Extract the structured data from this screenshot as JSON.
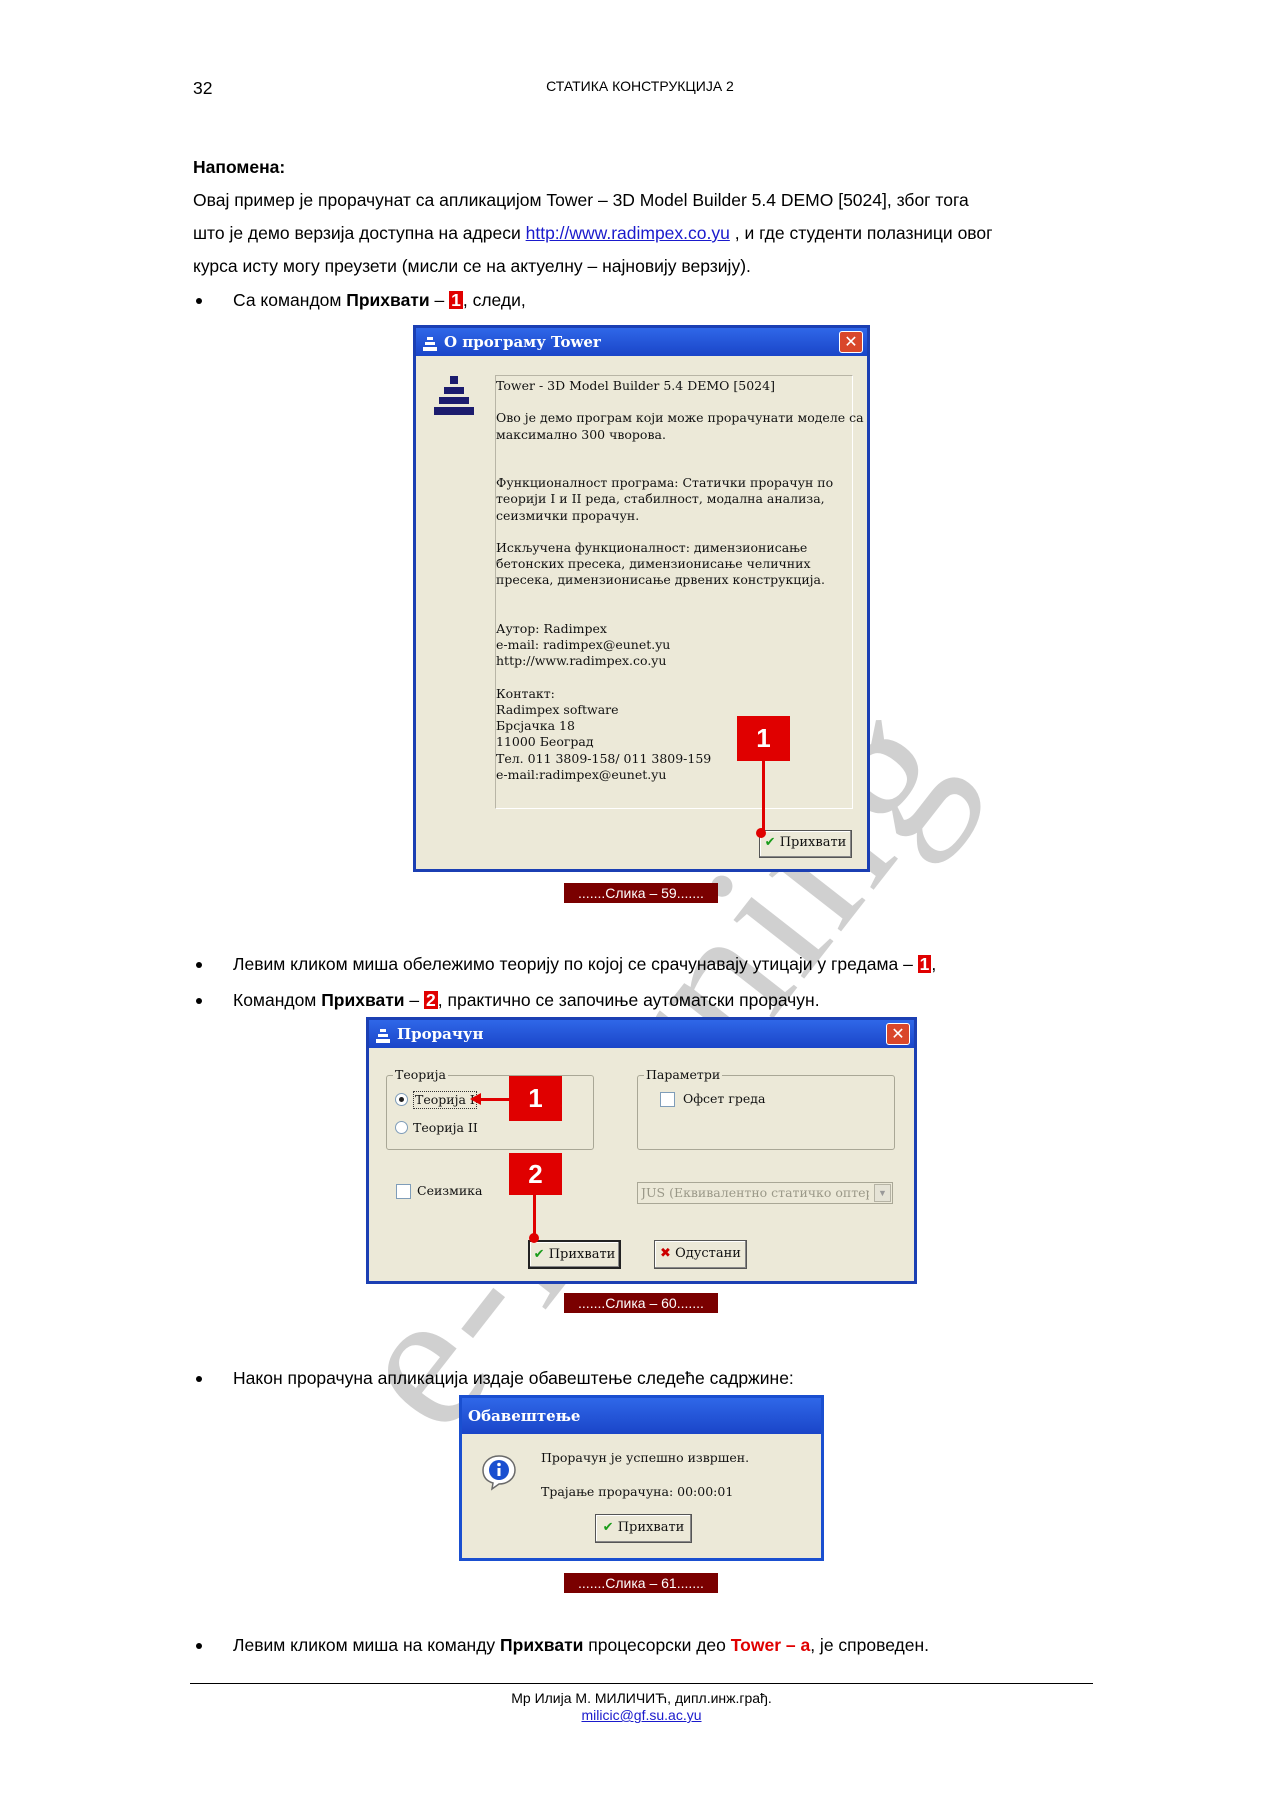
{
  "header": {
    "page_number": "32",
    "title": "СТАТИКА КОНСТРУКЦИЈА 2"
  },
  "note": {
    "heading": "Напомена:",
    "line1": "Овај пример је прорачунат са апликацијом Tower – 3D Model Builder 5.4 DEMO [5024], због тога",
    "line2_pre": "што је демо верзија доступна на адреси ",
    "line2_link": "http://www.radimpex.co.yu",
    "line2_post": " , и где студенти полазници овог",
    "line3": "курса исту могу преузети (мисли се на актуелну – најновију верзију)."
  },
  "bullet1": {
    "pre": "Са командом ",
    "bold": "Прихвати",
    "dash": " – ",
    "num": "1",
    "post": ", следи,"
  },
  "dialog1": {
    "title": "О програму Tower",
    "lines": [
      "Tower - 3D Model Builder 5.4 DEMO [5024]",
      "",
      "Ово је демо програм који може прорачунати моделе са",
      "максимално 300 чворова.",
      "",
      "",
      "Функционалност програма: Статички прорачун по",
      "теорији I и II реда, стабилност, модална анализа,",
      "сеизмички прорачун.",
      "",
      "Искључена функционалност: димензионисање",
      "бетонских пресека, димензионисање челичних",
      "пресека, димензионисање дрвених конструкција.",
      "",
      "",
      "Аутор: Radimpex",
      "e-mail: radimpex@eunet.yu",
      "http://www.radimpex.co.yu",
      "",
      "Контакт:",
      "Radimpex software",
      "Брсјачка 18",
      "11000 Београд",
      "Тел. 011 3809-158/ 011 3809-159",
      "e-mail:radimpex@eunet.yu"
    ],
    "accept": "Прихвати",
    "callout": "1"
  },
  "caption1": ".......Слика – 59.......",
  "bullet2": {
    "pre": "Левим кликом миша обележимо теорију по којој се срачунавају утицаји у гредама – ",
    "num": "1",
    "post": ","
  },
  "bullet3": {
    "pre": "Командом ",
    "bold": "Прихвати",
    "dash": " – ",
    "num": "2",
    "post": ", практично се започиње аутоматски прорачун."
  },
  "dialog2": {
    "title": "Прорачун",
    "theory_group": "Теорија",
    "theory1": "Теорија I",
    "theory2": "Теорија II",
    "params_group": "Параметри",
    "offset": "Офсет греда",
    "seismic": "Сеизмика",
    "standard": "JUS (Еквивалентно статичко оптере",
    "accept": "Прихвати",
    "cancel": "Одустани",
    "callout1": "1",
    "callout2": "2"
  },
  "caption2": ".......Слика – 60.......",
  "bullet4": "Након прорачуна апликација издаје обавештење следеће садржине:",
  "dialog3": {
    "title": "Обавештење",
    "message": "Прорачун је успешно извршен.",
    "duration": "Трајање прорачуна: 00:00:01",
    "accept": "Прихвати"
  },
  "caption3": ".......Слика – 61.......",
  "bullet5": {
    "pre": "Левим кликом миша на команду ",
    "bold": "Прихвати",
    "mid": " процесорски део ",
    "red": "Tower – a",
    "post": ", је спроведен."
  },
  "footer": {
    "author": "Мр Илија М. МИЛИЧИЋ, дипл.инж.грађ.",
    "email": "milicic@gf.su.ac.yu"
  },
  "watermark": "e-learning",
  "colors": {
    "callout_red": "#e00000",
    "caption_bg": "#7a0000",
    "xp_title_blue": "#1a45c8"
  }
}
